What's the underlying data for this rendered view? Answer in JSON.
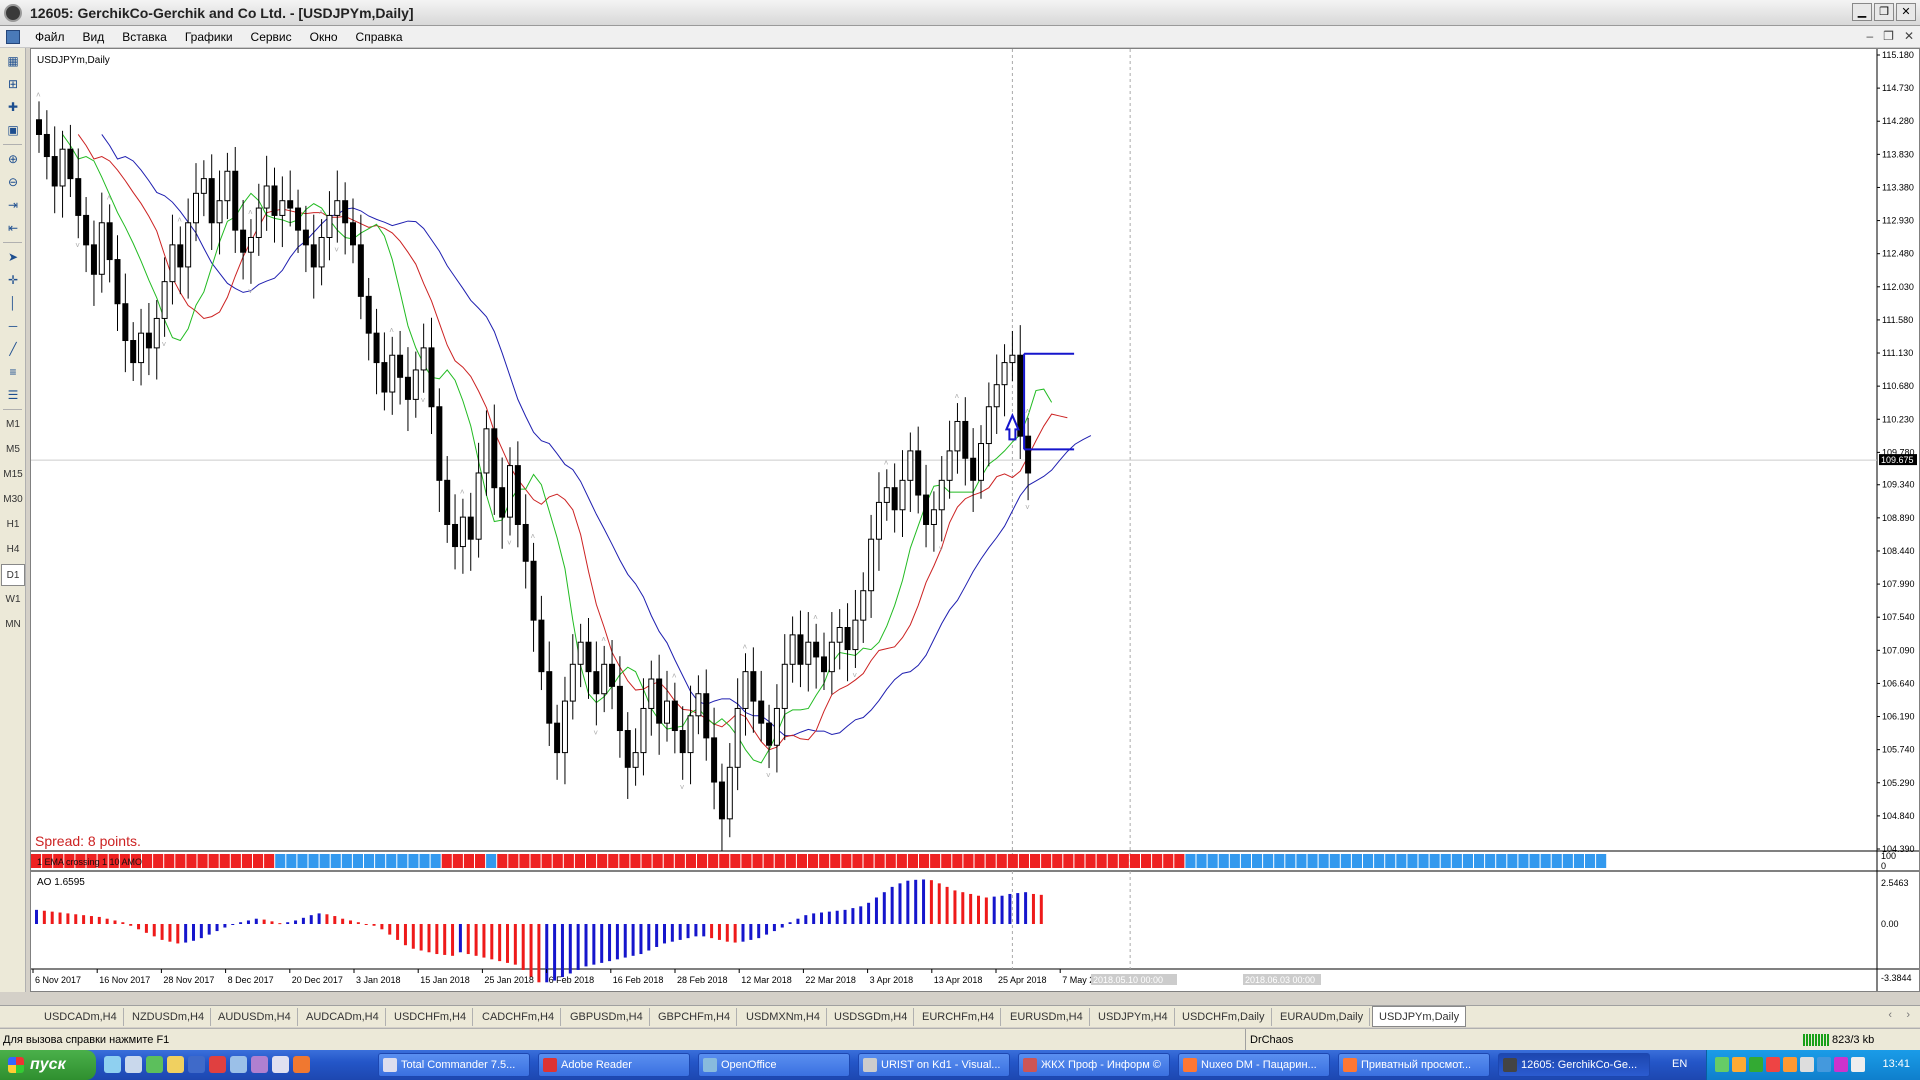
{
  "window": {
    "title": "12605: GerchikCo-Gerchik and Co Ltd. - [USDJPYm,Daily]"
  },
  "menu": [
    "Файл",
    "Вид",
    "Вставка",
    "Графики",
    "Сервис",
    "Окно",
    "Справка"
  ],
  "timeframes": [
    "M1",
    "M5",
    "M15",
    "M30",
    "H1",
    "H4",
    "D1",
    "W1",
    "MN"
  ],
  "active_timeframe": "D1",
  "chart": {
    "symbol_label": "USDJPYm,Daily",
    "spread_text": "Spread: 8 points.",
    "indicator_label": "1 EMA crossing 1 10 AMO",
    "indicator_scale": [
      "100",
      "0"
    ],
    "ao_label": "AO 1.6595",
    "ao_scale": [
      "2.5463",
      "0.00",
      "-3.3844"
    ],
    "current_price": "109.675",
    "cursor_time_label": "2018.05.10 00:00",
    "future_time_label": "2018.06.03 00:00",
    "price_ticks": [
      "115.180",
      "114.730",
      "114.280",
      "113.830",
      "113.380",
      "112.930",
      "112.480",
      "112.030",
      "111.580",
      "111.130",
      "110.680",
      "110.230",
      "109.780",
      "109.340",
      "108.890",
      "108.440",
      "107.990",
      "107.540",
      "107.090",
      "106.640",
      "106.190",
      "105.740",
      "105.290",
      "104.840",
      "104.390"
    ],
    "date_ticks": [
      "6 Nov 2017",
      "16 Nov 2017",
      "28 Nov 2017",
      "8 Dec 2017",
      "20 Dec 2017",
      "3 Jan 2018",
      "15 Jan 2018",
      "25 Jan 2018",
      "6 Feb 2018",
      "16 Feb 2018",
      "28 Feb 2018",
      "12 Mar 2018",
      "22 Mar 2018",
      "3 Apr 2018",
      "13 Apr 2018",
      "25 Apr 2018",
      "7 May 2"
    ],
    "colors": {
      "bull_band": "#3399ee",
      "bear_band": "#ee2222",
      "ma_fast": "#22bb22",
      "ma_mid": "#cc2222",
      "ma_slow": "#1f1fb0",
      "ao_up": "#1515cc",
      "ao_down": "#ee1a1a",
      "level": "#1515cc",
      "spread": "#cc2222"
    }
  },
  "chart_data": {
    "type": "candlestick",
    "title": "USDJPYm,Daily",
    "ylim": [
      104.39,
      115.18
    ],
    "closes": [
      114.1,
      113.8,
      113.4,
      113.9,
      113.5,
      113.0,
      112.6,
      112.2,
      112.9,
      112.4,
      111.8,
      111.3,
      111.0,
      111.4,
      111.2,
      111.6,
      112.1,
      112.6,
      112.3,
      112.9,
      113.3,
      113.5,
      112.9,
      113.2,
      113.6,
      112.8,
      112.5,
      112.7,
      113.1,
      113.4,
      113.0,
      113.2,
      113.1,
      112.8,
      112.6,
      112.3,
      112.7,
      113.0,
      113.2,
      112.9,
      112.6,
      111.9,
      111.4,
      111.0,
      110.6,
      111.1,
      110.8,
      110.5,
      110.9,
      111.2,
      110.4,
      109.4,
      108.8,
      108.5,
      108.9,
      108.6,
      109.5,
      110.1,
      109.3,
      108.9,
      109.6,
      108.8,
      108.3,
      107.5,
      106.8,
      106.1,
      105.7,
      106.4,
      106.9,
      107.2,
      106.8,
      106.5,
      106.9,
      106.6,
      106.0,
      105.5,
      105.7,
      106.3,
      106.7,
      106.1,
      106.4,
      106.0,
      105.7,
      106.2,
      106.5,
      105.9,
      105.3,
      104.8,
      105.5,
      106.3,
      106.8,
      106.4,
      106.1,
      105.8,
      106.3,
      106.9,
      107.3,
      106.9,
      107.2,
      107.0,
      106.8,
      107.2,
      107.4,
      107.1,
      107.5,
      107.9,
      108.6,
      109.1,
      109.3,
      109.0,
      109.4,
      109.8,
      109.2,
      108.8,
      109.0,
      109.4,
      109.8,
      110.2,
      109.7,
      109.4,
      109.9,
      110.4,
      110.7,
      111.0,
      111.1,
      110.0,
      109.5
    ],
    "last_price": 109.675,
    "levels": [
      111.12,
      109.82
    ],
    "indicator_band_sign": [
      1,
      1,
      1,
      1,
      1,
      1,
      1,
      1,
      1,
      1,
      1,
      1,
      1,
      1,
      1,
      1,
      1,
      1,
      1,
      1,
      1,
      1,
      -1,
      -1,
      -1,
      -1,
      -1,
      -1,
      -1,
      -1,
      -1,
      -1,
      -1,
      -1,
      -1,
      -1,
      -1,
      1,
      1,
      1,
      1,
      -1,
      1,
      1,
      1,
      1,
      1,
      1,
      1,
      1,
      1,
      1,
      1,
      1,
      1,
      1,
      1,
      1,
      1,
      1,
      1,
      1,
      1,
      1,
      1,
      1,
      1,
      1,
      1,
      1,
      1,
      1,
      1,
      1,
      1,
      1,
      1,
      1,
      1,
      1,
      1,
      1,
      1,
      1,
      1,
      1,
      1,
      1,
      1,
      1,
      1,
      1,
      1,
      1,
      1,
      1,
      1,
      1,
      1,
      1,
      1,
      1,
      1,
      1,
      -1,
      -1,
      -1,
      -1,
      -1,
      -1,
      -1,
      -1,
      -1,
      -1,
      -1,
      -1,
      -1,
      -1,
      -1,
      -1,
      -1,
      -1,
      -1,
      -1,
      -1,
      -1,
      -1,
      -1,
      -1,
      -1,
      -1,
      -1,
      -1,
      -1,
      -1,
      -1,
      -1,
      -1,
      -1,
      -1,
      -1,
      -1
    ],
    "ao_values": [
      0.8,
      0.75,
      0.7,
      0.65,
      0.6,
      0.55,
      0.5,
      0.45,
      0.4,
      0.3,
      0.2,
      0.1,
      -0.1,
      -0.3,
      -0.5,
      -0.7,
      -0.9,
      -1.0,
      -1.1,
      -1.05,
      -0.95,
      -0.8,
      -0.6,
      -0.4,
      -0.2,
      -0.05,
      0.1,
      0.2,
      0.3,
      0.25,
      0.15,
      0.05,
      0.1,
      0.2,
      0.35,
      0.5,
      0.6,
      0.55,
      0.45,
      0.3,
      0.2,
      0.1,
      0.0,
      -0.1,
      -0.3,
      -0.6,
      -0.9,
      -1.2,
      -1.4,
      -1.5,
      -1.6,
      -1.7,
      -1.75,
      -1.8,
      -1.6,
      -1.7,
      -1.8,
      -1.9,
      -2.0,
      -2.1,
      -2.2,
      -2.3,
      -2.6,
      -3.0,
      -3.3,
      -3.3,
      -3.2,
      -3.0,
      -2.8,
      -2.6,
      -2.4,
      -2.3,
      -2.2,
      -2.1,
      -2.0,
      -1.9,
      -1.8,
      -1.7,
      -1.5,
      -1.3,
      -1.1,
      -1.0,
      -0.9,
      -0.8,
      -0.7,
      -0.7,
      -0.8,
      -0.9,
      -1.0,
      -1.05,
      -1.0,
      -0.9,
      -0.8,
      -0.6,
      -0.4,
      -0.2,
      0.1,
      0.3,
      0.5,
      0.6,
      0.65,
      0.7,
      0.75,
      0.8,
      0.9,
      1.0,
      1.2,
      1.5,
      1.8,
      2.1,
      2.3,
      2.45,
      2.5,
      2.52,
      2.48,
      2.3,
      2.1,
      1.9,
      1.8,
      1.7,
      1.6,
      1.5,
      1.55,
      1.6,
      1.7,
      1.75,
      1.8,
      1.7,
      1.65
    ]
  },
  "bottom_tabs": [
    "USDCADm,H4",
    "NZDUSDm,H4",
    "AUDUSDm,H4",
    "AUDCADm,H4",
    "USDCHFm,H4",
    "CADCHFm,H4",
    "GBPUSDm,H4",
    "GBPCHFm,H4",
    "USDMXNm,H4",
    "USDSGDm,H4",
    "EURCHFm,H4",
    "EURUSDm,H4",
    "USDJPYm,H4",
    "USDCHFm,Daily",
    "EURAUDm,Daily",
    "USDJPYm,Daily"
  ],
  "active_tab": "USDJPYm,Daily",
  "statusbar": {
    "help": "Для вызова справки нажмите F1",
    "profile": "DrChaos",
    "connection": "823/3 kb"
  },
  "taskbar": {
    "start": "пуск",
    "tasks": [
      "Total Commander 7.5...",
      "Adobe Reader",
      "OpenOffice",
      "URIST on Kd1 - Visual...",
      "ЖКХ Проф - Информ ©",
      "Nuxeo DM - Пацарин...",
      "Приватный просмот...",
      "12605: GerchikCo-Ge..."
    ],
    "lang": "EN",
    "clock": "13:41"
  }
}
